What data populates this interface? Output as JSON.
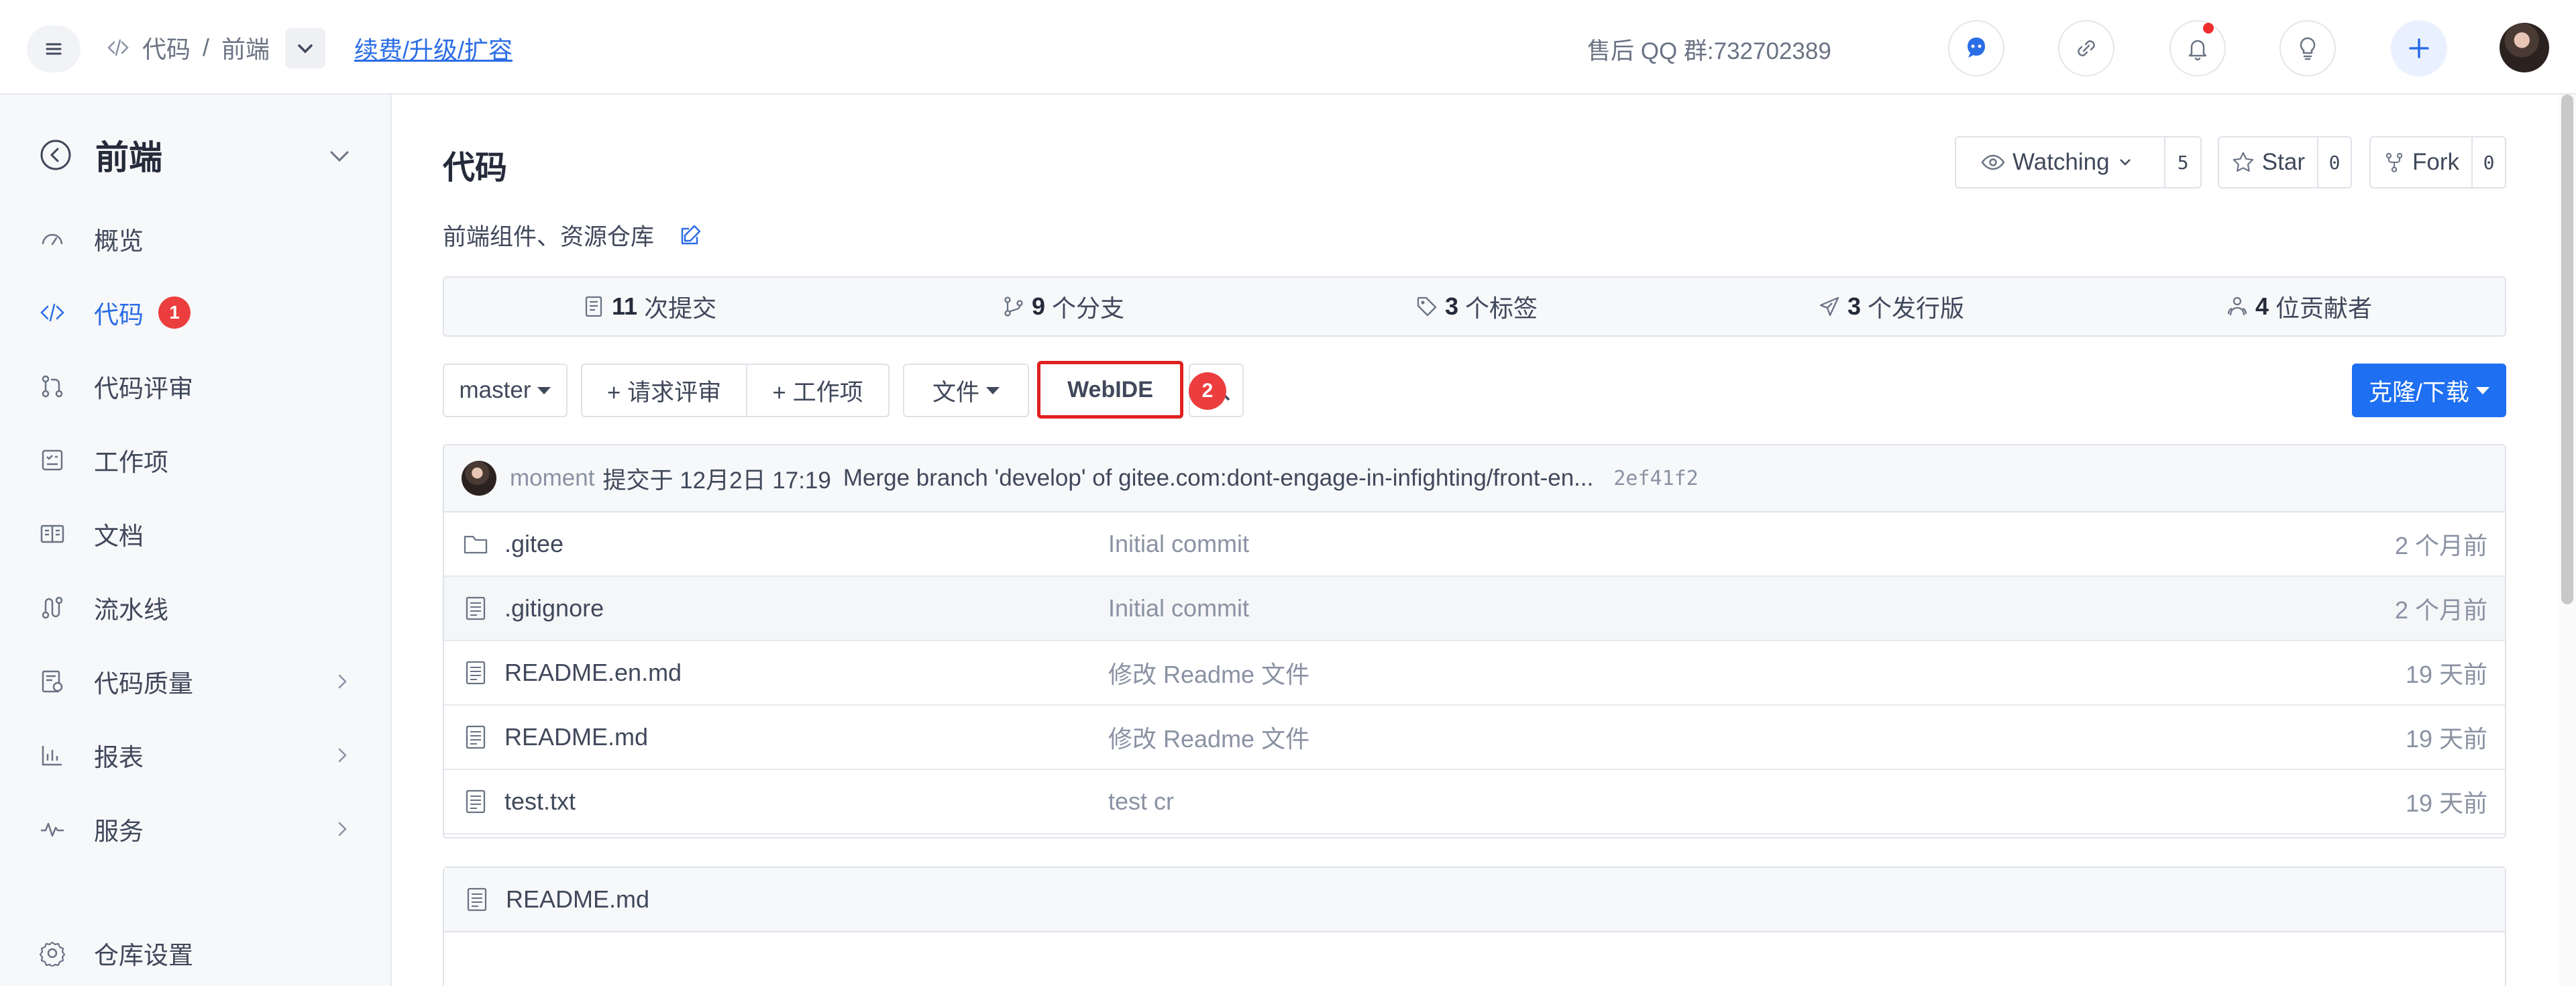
{
  "topbar": {
    "breadcrumb": [
      "代码",
      "/",
      "前端"
    ],
    "renew_link": "续费/升级/扩容",
    "qq_group": "售后 QQ 群:732702389"
  },
  "sidebar": {
    "title": "前端",
    "items": [
      {
        "label": "概览",
        "icon": "dashboard-icon"
      },
      {
        "label": "代码",
        "icon": "code-icon",
        "badge": "1",
        "active": true
      },
      {
        "label": "代码评审",
        "icon": "pull-request-icon"
      },
      {
        "label": "工作项",
        "icon": "task-icon"
      },
      {
        "label": "文档",
        "icon": "book-icon"
      },
      {
        "label": "流水线",
        "icon": "pipeline-icon"
      },
      {
        "label": "代码质量",
        "icon": "quality-icon"
      },
      {
        "label": "报表",
        "icon": "chart-icon"
      },
      {
        "label": "服务",
        "icon": "service-icon"
      },
      {
        "label": "仓库设置",
        "icon": "gear-icon"
      }
    ]
  },
  "repo": {
    "title": "代码",
    "description": "前端组件、资源仓库",
    "watching_label": "Watching",
    "watching_count": "5",
    "star_label": "Star",
    "star_count": "0",
    "fork_label": "Fork",
    "fork_count": "0"
  },
  "stats": {
    "commits_count": "11",
    "commits_label": "次提交",
    "branches_count": "9",
    "branches_label": "个分支",
    "tags_count": "3",
    "tags_label": "个标签",
    "releases_count": "3",
    "releases_label": "个发行版",
    "contributors_count": "4",
    "contributors_label": "位贡献者"
  },
  "toolbar": {
    "branch": "master",
    "request_review": "+ 请求评审",
    "work_item": "+ 工作项",
    "file": "文件",
    "webide": "WebIDE",
    "webide_badge": "2",
    "clone": "克隆/下载"
  },
  "commit": {
    "author": "moment",
    "date": "提交于 12月2日 17:19",
    "message": "Merge branch 'develop' of gitee.com:dont-engage-in-infighting/front-en...",
    "hash": "2ef41f2"
  },
  "files": [
    {
      "name": ".gitee",
      "type": "folder",
      "message": "Initial commit",
      "time": "2 个月前"
    },
    {
      "name": ".gitignore",
      "type": "file",
      "message": "Initial commit",
      "time": "2 个月前"
    },
    {
      "name": "README.en.md",
      "type": "file",
      "message": "修改 Readme 文件",
      "time": "19 天前"
    },
    {
      "name": "README.md",
      "type": "file",
      "message": "修改 Readme 文件",
      "time": "19 天前"
    },
    {
      "name": "test.txt",
      "type": "file",
      "message": "test cr",
      "time": "19 天前"
    }
  ],
  "readme": {
    "title": "README.md"
  }
}
